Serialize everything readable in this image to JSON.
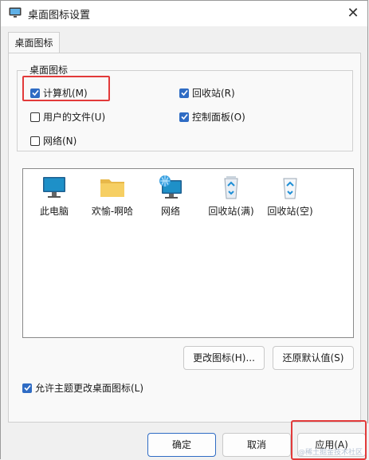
{
  "window": {
    "title": "桌面图标设置",
    "close_glyph": "✕"
  },
  "tab": {
    "label": "桌面图标"
  },
  "group": {
    "title": "桌面图标"
  },
  "checkboxes": [
    {
      "label": "计算机(M)",
      "checked": true
    },
    {
      "label": "回收站(R)",
      "checked": true
    },
    {
      "label": "用户的文件(U)",
      "checked": false
    },
    {
      "label": "控制面板(O)",
      "checked": true
    },
    {
      "label": "网络(N)",
      "checked": false
    }
  ],
  "icons": [
    {
      "label": "此电脑",
      "icon": "monitor-icon"
    },
    {
      "label": "欢愉-啊哈",
      "icon": "folder-icon"
    },
    {
      "label": "网络",
      "icon": "network-icon"
    },
    {
      "label": "回收站(满)",
      "icon": "recycle-bin-full-icon"
    },
    {
      "label": "回收站(空)",
      "icon": "recycle-bin-empty-icon"
    }
  ],
  "buttons": {
    "change_icon": "更改图标(H)...",
    "restore_default": "还原默认值(S)",
    "ok": "确定",
    "cancel": "取消",
    "apply": "应用(A)"
  },
  "theme_checkbox": {
    "label": "允许主题更改桌面图标(L)",
    "checked": true
  },
  "watermark": "@稀土掘金技术社区",
  "colors": {
    "accent": "#2f6cc4",
    "highlight": "#e23a3a"
  }
}
